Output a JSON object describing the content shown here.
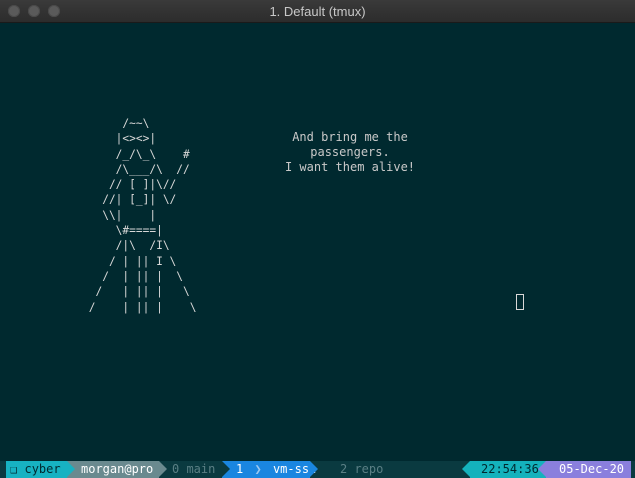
{
  "window": {
    "title": "1. Default (tmux)"
  },
  "terminal": {
    "ascii_art": "      /~~\\\n     |<><>|\n     /_/\\_\\    #\n     /\\___/\\  //\n    // [ ]|\\//\n   //| [_]| \\/\n   \\\\|    |\n     \\#====|\n     /|\\  /I\\\n    / | || I \\\n   /  | || |  \\\n  /   | || |   \\\n /    | || |    \\",
    "quote_line1": "And bring me the passengers.",
    "quote_line2": "I want them alive!"
  },
  "statusbar": {
    "session_icon": "❑",
    "session_name": "cyber",
    "user_host": "morgan@pro",
    "window0": "0 main",
    "window1_index": "1",
    "window1_sep": "❯",
    "window1_name": "vm-ssh",
    "window2": "2 repo",
    "time": "22:54:36",
    "date": "05-Dec-20"
  },
  "colors": {
    "background": "#00292f",
    "session": "#17b2c2",
    "user": "#6a8a8f",
    "active_window": "#1a86e0",
    "time": "#14b2bc",
    "date": "#8a7fdd"
  }
}
